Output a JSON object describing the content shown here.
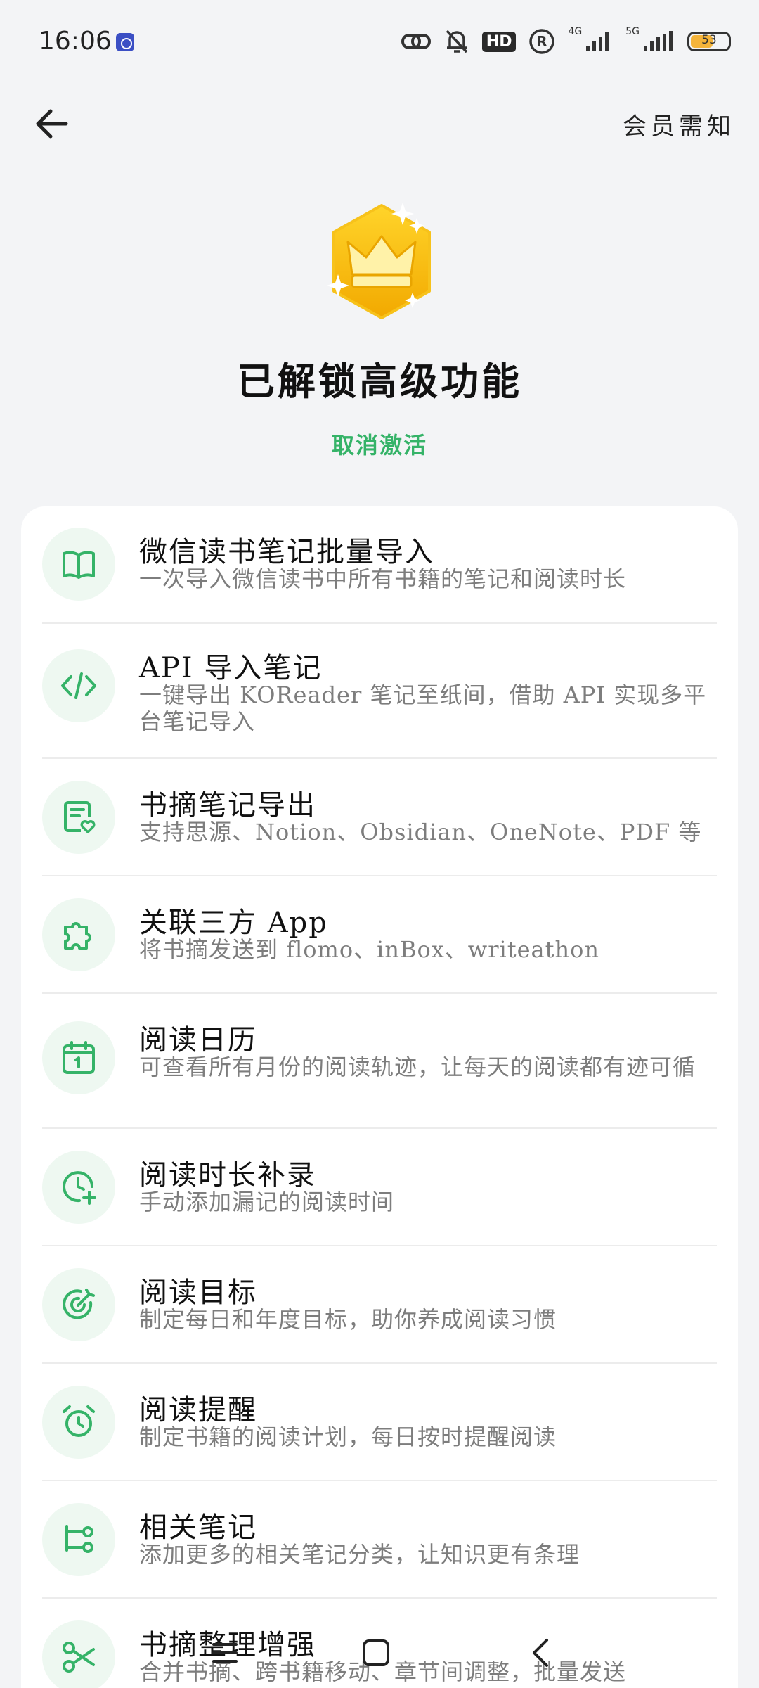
{
  "status_bar": {
    "time": "16:06",
    "hd_badge": "HD",
    "net_4g": "4G",
    "net_5g": "5G",
    "battery": "53",
    "battery_level": 0.53
  },
  "header": {
    "notice_label": "会员需知"
  },
  "hero": {
    "title": "已解锁高级功能",
    "cancel_label": "取消激活"
  },
  "features": [
    {
      "icon": "book-icon",
      "title": "微信读书笔记批量导入",
      "desc": "一次导入微信读书中所有书籍的笔记和阅读时长"
    },
    {
      "icon": "code-icon",
      "title": "API 导入笔记",
      "desc": "一键导出 KOReader 笔记至纸间，借助 API 实现多平台笔记导入"
    },
    {
      "icon": "note-export-icon",
      "title": "书摘笔记导出",
      "desc": "支持思源、Notion、Obsidian、OneNote、PDF 等"
    },
    {
      "icon": "puzzle-icon",
      "title": "关联三方 App",
      "desc": "将书摘发送到 flomo、inBox、writeathon"
    },
    {
      "icon": "calendar-icon",
      "title": "阅读日历",
      "desc": "可查看所有月份的阅读轨迹，让每天的阅读都有迹可循"
    },
    {
      "icon": "clock-plus-icon",
      "title": "阅读时长补录",
      "desc": "手动添加漏记的阅读时间"
    },
    {
      "icon": "target-icon",
      "title": "阅读目标",
      "desc": "制定每日和年度目标，助你养成阅读习惯"
    },
    {
      "icon": "alarm-icon",
      "title": "阅读提醒",
      "desc": "制定书籍的阅读计划，每日按时提醒阅读"
    },
    {
      "icon": "branch-icon",
      "title": "相关笔记",
      "desc": "添加更多的相关笔记分类，让知识更有条理"
    },
    {
      "icon": "scissors-icon",
      "title": "书摘整理增强",
      "desc": "合并书摘、跨书籍移动、章节间调整，批量发送"
    }
  ],
  "colors": {
    "accent": "#35b368",
    "icon_bg": "#eef8f1",
    "crown_gold": "#f7c21b"
  }
}
